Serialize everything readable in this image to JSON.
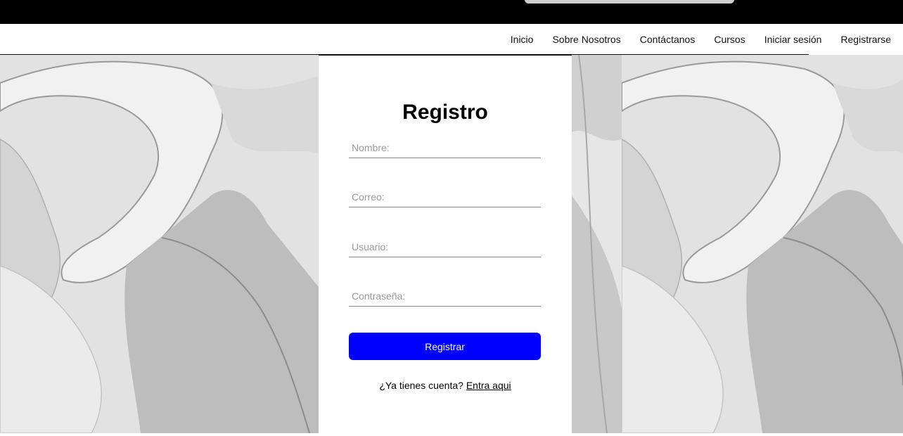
{
  "nav": {
    "links": [
      "Inicio",
      "Sobre Nosotros",
      "Contáctanos",
      "Cursos",
      "Iniciar sesión",
      "Registrarse"
    ]
  },
  "form": {
    "title": "Registro",
    "fields": {
      "name_placeholder": "Nombre:",
      "email_placeholder": "Correo:",
      "user_placeholder": "Usuario:",
      "password_placeholder": "Contraseña:"
    },
    "submit_label": "Registrar",
    "login_prompt": "¿Ya tienes cuenta?",
    "login_link": "Entra aqui"
  },
  "colors": {
    "accent": "#0000ff",
    "topbar": "#000000"
  }
}
